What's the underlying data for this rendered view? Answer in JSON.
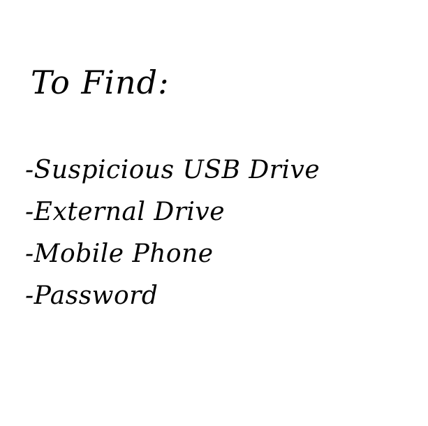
{
  "note": {
    "title": "To Find:",
    "items": [
      "-Suspicious USB Drive",
      "-External Drive",
      "-Mobile Phone",
      "-Password"
    ],
    "text_color": "#000000",
    "background_color": "#ffffff"
  }
}
